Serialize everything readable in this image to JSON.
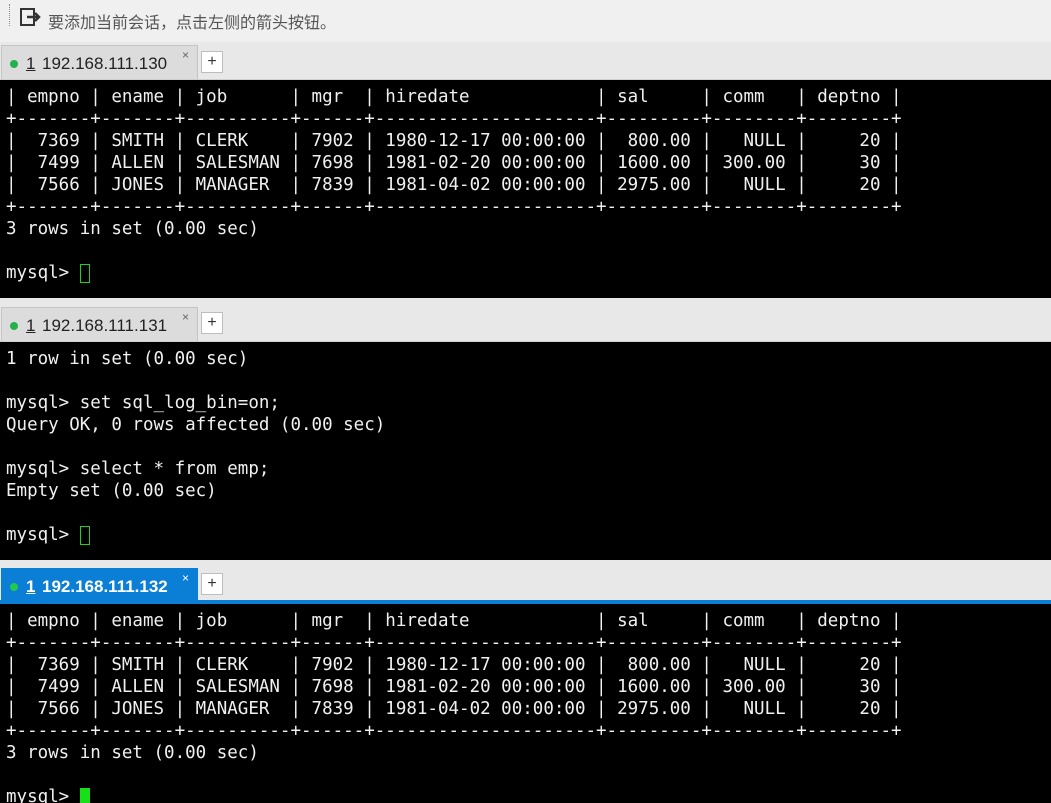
{
  "hint_bar": {
    "icon": "arrow-session-icon",
    "text": "要添加当前会话，点击左侧的箭头按钮。"
  },
  "sessions": [
    {
      "tab": {
        "number": "1",
        "host": "192.168.111.130",
        "close": "×",
        "active": false
      },
      "new_tab_label": "+",
      "lines": [
        "| empno | ename | job      | mgr  | hiredate            | sal     | comm   | deptno |",
        "+-------+-------+----------+------+---------------------+---------+--------+--------+",
        "|  7369 | SMITH | CLERK    | 7902 | 1980-12-17 00:00:00 |  800.00 |   NULL |     20 |",
        "|  7499 | ALLEN | SALESMAN | 7698 | 1981-02-20 00:00:00 | 1600.00 | 300.00 |     30 |",
        "|  7566 | JONES | MANAGER  | 7839 | 1981-04-02 00:00:00 | 2975.00 |   NULL |     20 |",
        "+-------+-------+----------+------+---------------------+---------+--------+--------+",
        "3 rows in set (0.00 sec)",
        ""
      ],
      "prompt": "mysql> "
    },
    {
      "tab": {
        "number": "1",
        "host": "192.168.111.131",
        "close": "×",
        "active": false
      },
      "new_tab_label": "+",
      "lines": [
        "1 row in set (0.00 sec)",
        "",
        "mysql> set sql_log_bin=on;",
        "Query OK, 0 rows affected (0.00 sec)",
        "",
        "mysql> select * from emp;",
        "Empty set (0.00 sec)",
        ""
      ],
      "prompt": "mysql> "
    },
    {
      "tab": {
        "number": "1",
        "host": "192.168.111.132",
        "close": "×",
        "active": true
      },
      "new_tab_label": "+",
      "lines": [
        "| empno | ename | job      | mgr  | hiredate            | sal     | comm   | deptno |",
        "+-------+-------+----------+------+---------------------+---------+--------+--------+",
        "|  7369 | SMITH | CLERK    | 7902 | 1980-12-17 00:00:00 |  800.00 |   NULL |     20 |",
        "|  7499 | ALLEN | SALESMAN | 7698 | 1981-02-20 00:00:00 | 1600.00 | 300.00 |     30 |",
        "|  7566 | JONES | MANAGER  | 7839 | 1981-04-02 00:00:00 | 2975.00 |   NULL |     20 |",
        "+-------+-------+----------+------+---------------------+---------+--------+--------+",
        "3 rows in set (0.00 sec)",
        ""
      ],
      "prompt": "mysql> "
    }
  ],
  "colors": {
    "active_tab": "#0b7fd6",
    "status_dot": "#22b14c",
    "cursor": "#1ed11e",
    "terminal_bg": "#000000",
    "terminal_fg": "#f0f0f0"
  }
}
